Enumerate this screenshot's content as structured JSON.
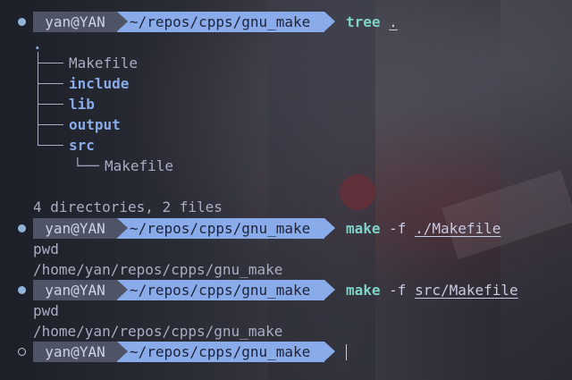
{
  "prompt": {
    "user": "yan@YAN",
    "path": "~/repos/cpps/gnu_make"
  },
  "commands": [
    {
      "cmd": "tree",
      "args": "",
      "target": "."
    },
    {
      "cmd": "make",
      "args": "-f",
      "target": "./Makefile"
    },
    {
      "cmd": "make",
      "args": "-f",
      "target": "src/Makefile"
    }
  ],
  "tree": {
    "root": ".",
    "entries": [
      {
        "name": "Makefile",
        "type": "file"
      },
      {
        "name": "include",
        "type": "dir"
      },
      {
        "name": "lib",
        "type": "dir"
      },
      {
        "name": "output",
        "type": "dir"
      },
      {
        "name": "src",
        "type": "dir"
      }
    ],
    "sub_entry": {
      "name": "Makefile",
      "type": "file",
      "prefix": "└──"
    },
    "summary": "4 directories, 2 files"
  },
  "outputs": {
    "run1": [
      "pwd",
      "/home/yan/repos/cpps/gnu_make"
    ],
    "run2": [
      "pwd",
      "/home/yan/repos/cpps/gnu_make"
    ]
  },
  "icons": {
    "prompt_status": "filled-dot-icon",
    "active_prompt_status": "hollow-dot-icon"
  },
  "colors": {
    "user_segment": "#4e5366",
    "path_segment": "#8aabea",
    "command": "#7fd2c8",
    "directory": "#8aabea"
  }
}
